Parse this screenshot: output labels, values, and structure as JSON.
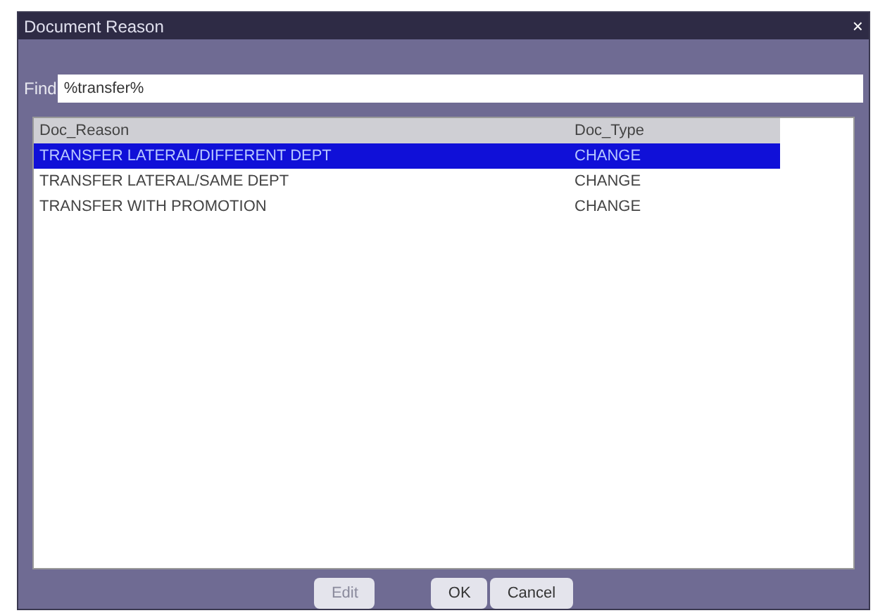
{
  "window": {
    "title": "Document Reason",
    "close": "×"
  },
  "find": {
    "label": "Find",
    "value": "%transfer%"
  },
  "table": {
    "columns": [
      "Doc_Reason",
      "Doc_Type"
    ],
    "rows": [
      {
        "cells": [
          "TRANSFER LATERAL/DIFFERENT DEPT",
          "CHANGE"
        ],
        "selected": true
      },
      {
        "cells": [
          "TRANSFER LATERAL/SAME DEPT",
          "CHANGE"
        ],
        "selected": false
      },
      {
        "cells": [
          "TRANSFER WITH PROMOTION",
          "CHANGE"
        ],
        "selected": false
      }
    ]
  },
  "buttons": [
    {
      "label": "Edit",
      "disabled": true
    },
    {
      "label": "OK",
      "disabled": false
    },
    {
      "label": "Cancel",
      "disabled": false
    }
  ]
}
